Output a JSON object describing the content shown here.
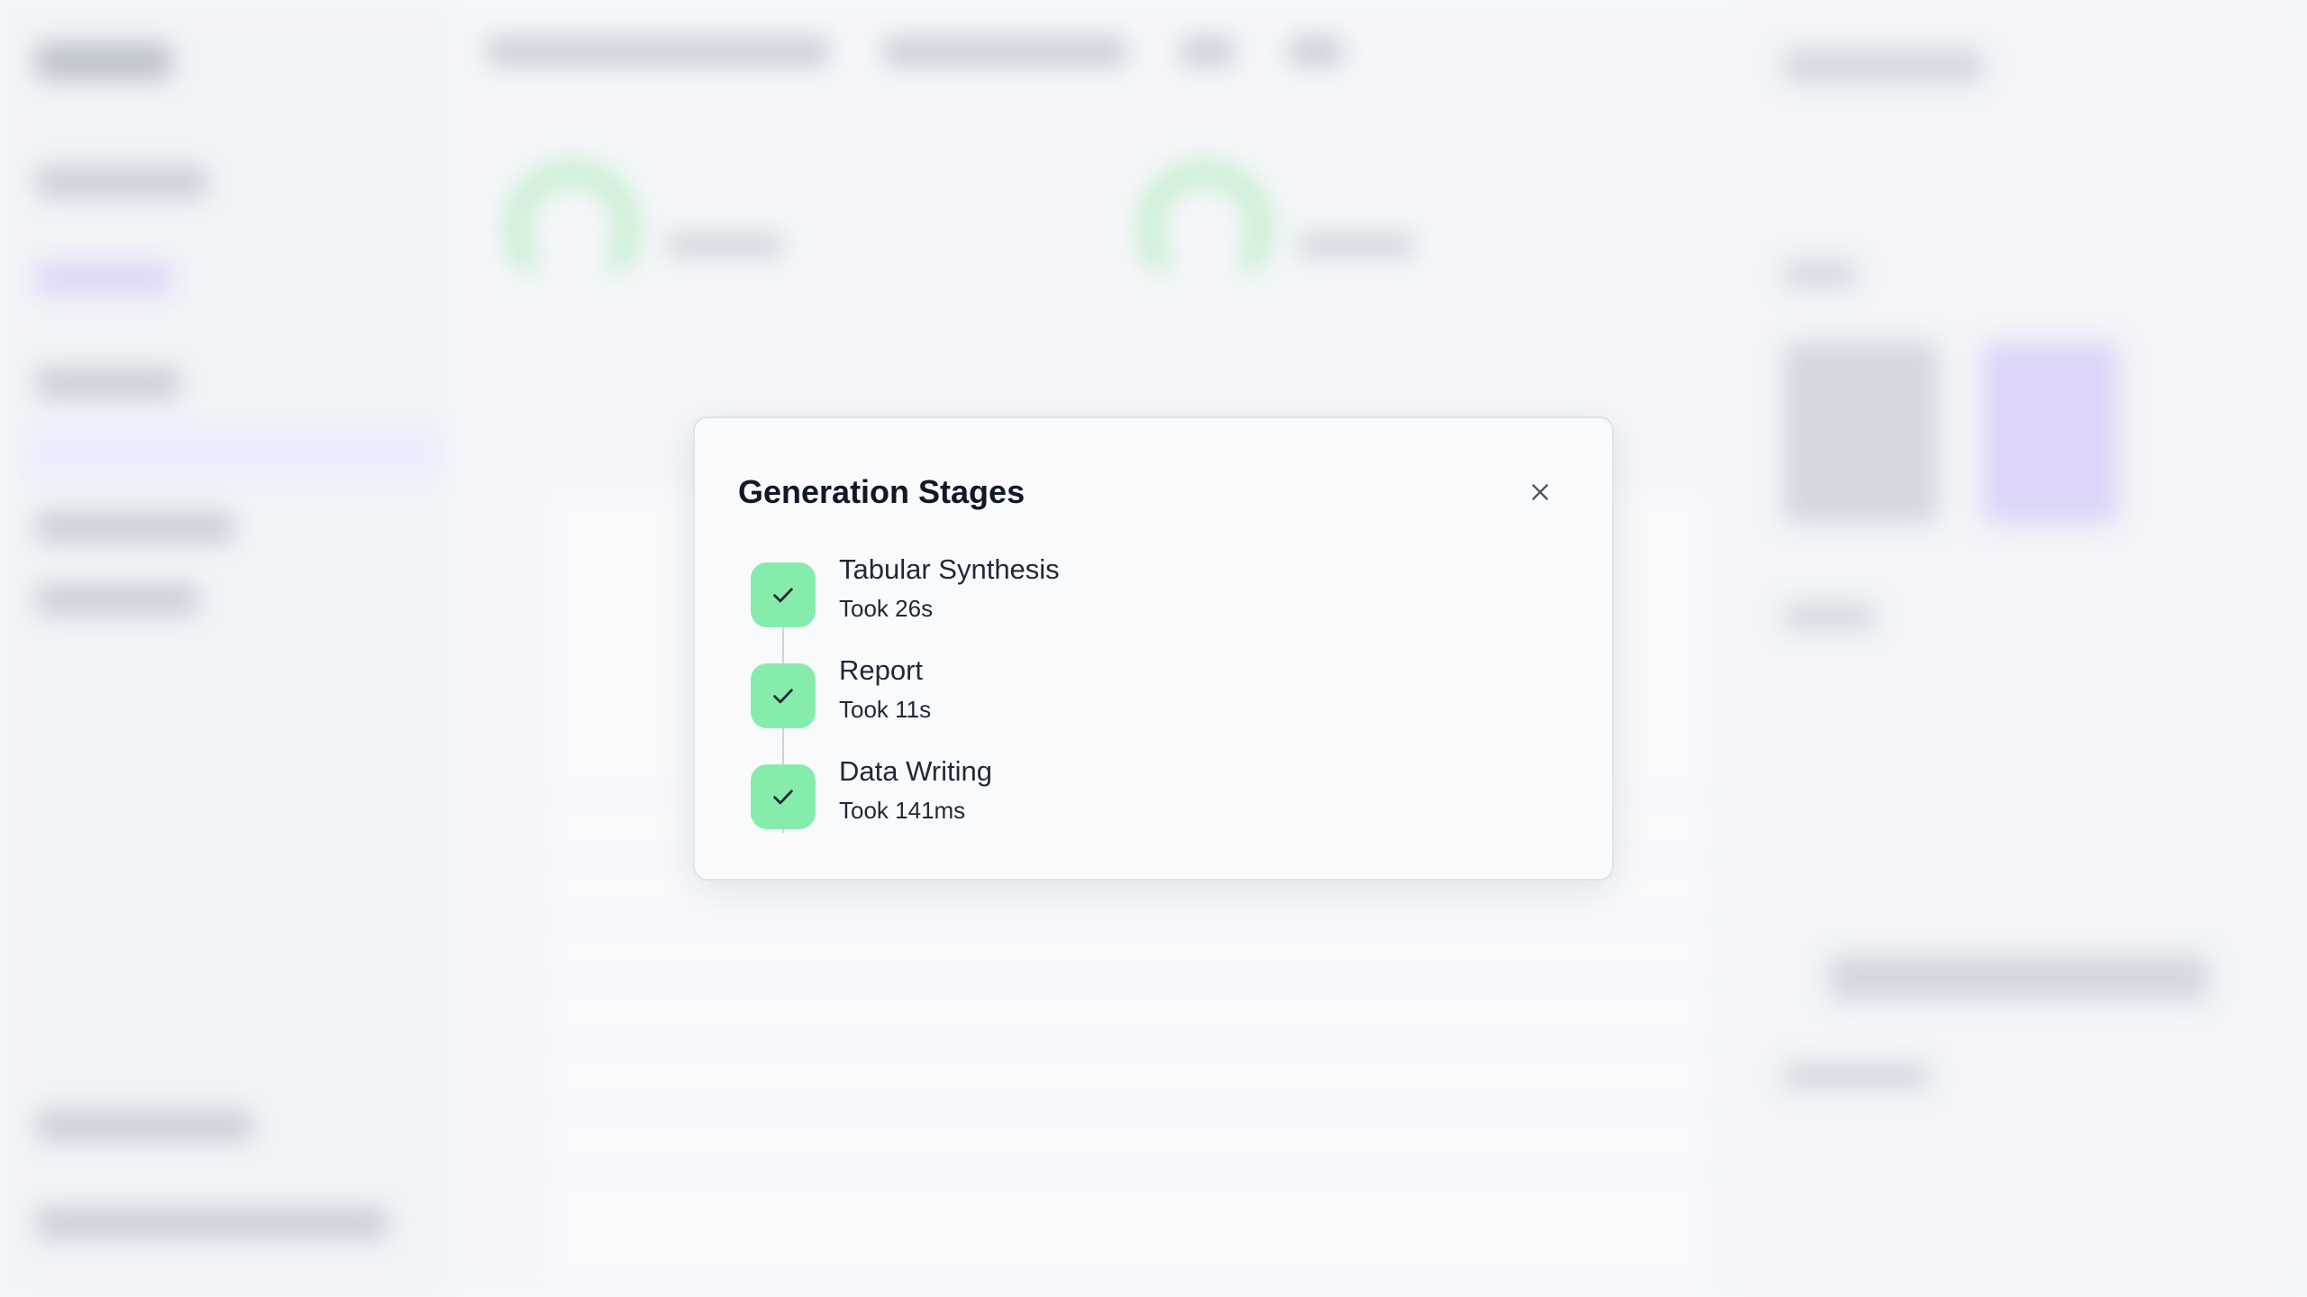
{
  "modal": {
    "title": "Generation Stages",
    "close_icon": "close-icon",
    "stages": [
      {
        "name": "Tabular Synthesis",
        "duration": "Took 26s",
        "status": "complete",
        "icon": "check-icon"
      },
      {
        "name": "Report",
        "duration": "Took 11s",
        "status": "complete",
        "icon": "check-icon"
      },
      {
        "name": "Data Writing",
        "duration": "Took 141ms",
        "status": "complete",
        "icon": "check-icon"
      }
    ]
  },
  "colors": {
    "complete": "#86ecab",
    "check": "#1f2a2e",
    "connector": "#cdd3db"
  }
}
